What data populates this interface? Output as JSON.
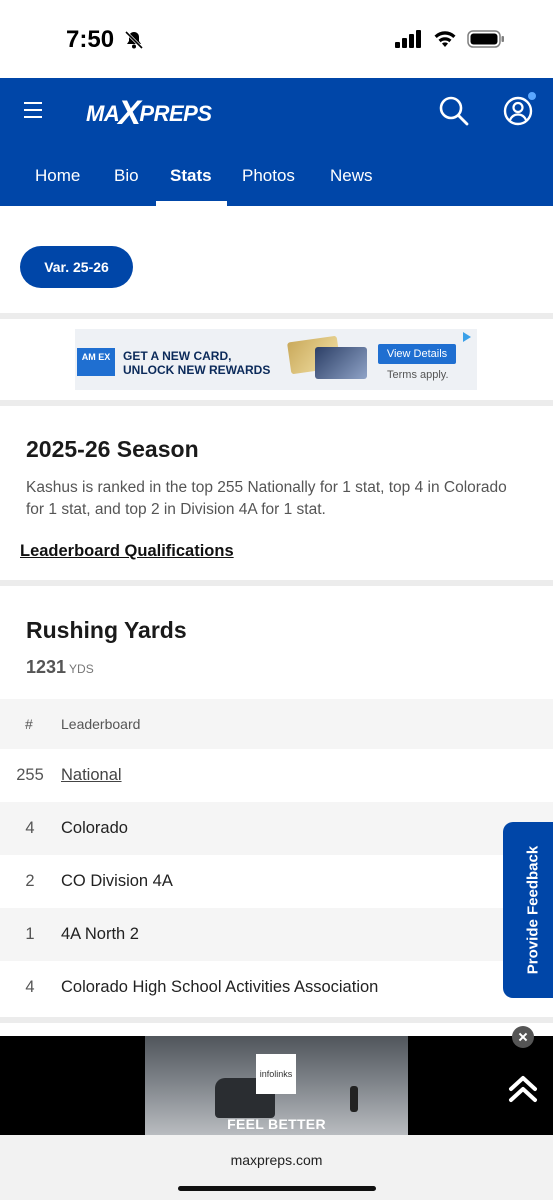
{
  "status_bar": {
    "time": "7:50"
  },
  "header": {
    "logo_text_left": "MA",
    "logo_x": "X",
    "logo_text_right": "PREPS"
  },
  "tabs": [
    {
      "label": "Home"
    },
    {
      "label": "Bio"
    },
    {
      "label": "Stats",
      "active": true
    },
    {
      "label": "Photos"
    },
    {
      "label": "News"
    }
  ],
  "season_selector": {
    "label": "Var. 25-26"
  },
  "ad_banner": {
    "logo_text": "AM EX",
    "headline_line1": "GET A NEW CARD,",
    "headline_line2": "UNLOCK NEW REWARDS",
    "cta": "View Details",
    "terms": "Terms apply."
  },
  "season": {
    "title": "2025-26 Season",
    "description": "Kashus is ranked in the top 255 Nationally for 1 stat, top 4 in Colorado for 1 stat, and top 2 in Division 4A for 1 stat.",
    "link": "Leaderboard Qualifications"
  },
  "rushing": {
    "title": "Rushing Yards",
    "value": "1231",
    "unit": "YDS",
    "headers": {
      "rank": "#",
      "board": "Leaderboard"
    },
    "rows": [
      {
        "rank": "255",
        "name": "National"
      },
      {
        "rank": "4",
        "name": "Colorado"
      },
      {
        "rank": "2",
        "name": "CO Division 4A"
      },
      {
        "rank": "1",
        "name": "4A North 2"
      },
      {
        "rank": "4",
        "name": "Colorado High School Activities Association"
      }
    ]
  },
  "feedback": {
    "label": "Provide Feedback"
  },
  "bottom_ad": {
    "brand": "infolinks",
    "tagline": "FEEL BETTER"
  },
  "browser": {
    "url": "maxpreps.com"
  },
  "colors": {
    "brand_blue": "#0046a8"
  }
}
